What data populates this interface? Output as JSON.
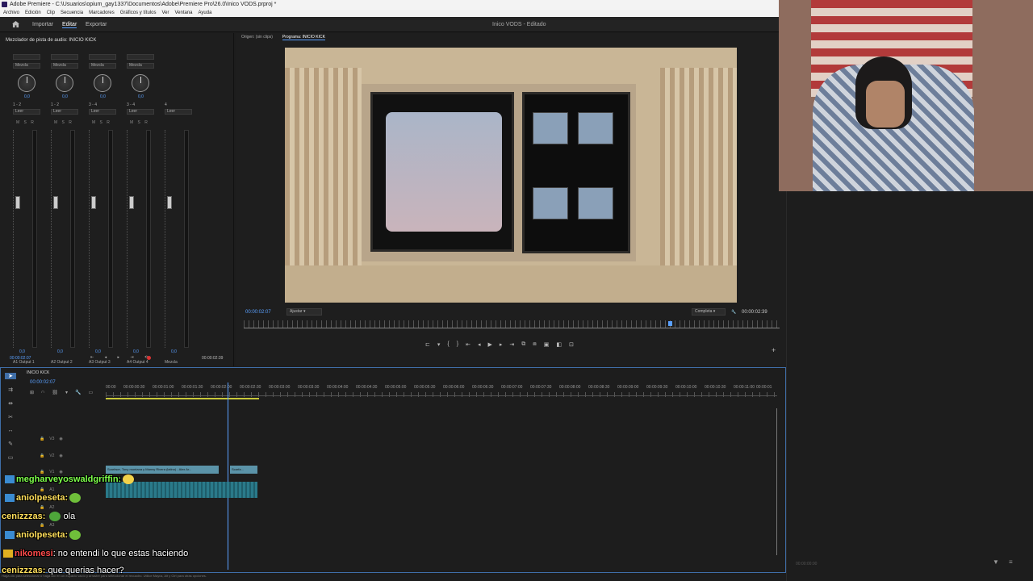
{
  "window": {
    "title": "Adobe Premiere - C:\\Usuarios\\opium_gay1337\\Documentos\\Adobe\\Premiere Pro\\26.0\\Inico VODS.prproj *"
  },
  "menu": [
    "Archivo",
    "Edición",
    "Clip",
    "Secuencia",
    "Marcadores",
    "Gráficos y títulos",
    "Ver",
    "Ventana",
    "Ayuda"
  ],
  "workspace": {
    "tabs": [
      "Importar",
      "Editar",
      "Exportar"
    ],
    "active": "Editar",
    "doc_title": "Inico VODS - Editado"
  },
  "mixer": {
    "title": "Mezclador de pista de audio: INICIO KICK",
    "channels": [
      {
        "mode": "Mezcla",
        "value": "0,0",
        "route": "1 - 2",
        "auto": "Leer",
        "foot": "0,0",
        "label": "A1",
        "output": "Output 1"
      },
      {
        "mode": "Mezcla",
        "value": "0,0",
        "route": "1 - 2",
        "auto": "Leer",
        "foot": "0,0",
        "label": "A2",
        "output": "Output 2"
      },
      {
        "mode": "Mezcla",
        "value": "0,0",
        "route": "3 - 4",
        "auto": "Leer",
        "foot": "0,0",
        "label": "A3",
        "output": "Output 3"
      },
      {
        "mode": "Mezcla",
        "value": "0,0",
        "route": "3 - 4",
        "auto": "Leer",
        "foot": "0,0",
        "label": "A4",
        "output": "Output 4"
      },
      {
        "mode": "",
        "value": "",
        "route": "4",
        "auto": "Leer",
        "foot": "0,0",
        "label": "",
        "output": "Mezcla"
      }
    ],
    "time_left": "00:00:02:07",
    "time_right": "00:00:02:39"
  },
  "program": {
    "source_tab": "Origen: (sin clips)",
    "program_tab": "Programa: INICIO KICK",
    "timecode": "00:00:02:07",
    "fit": "Ajustar",
    "quality": "Completa",
    "duration": "00:00:02:39"
  },
  "timeline": {
    "sequence": "INICIO KICK",
    "timecode": "00:00:02:07",
    "ruler": [
      "00:00",
      "00:00:00:30",
      "00:00:01:00",
      "00:00:01:30",
      "00:00:02:00",
      "00:00:02:30",
      "00:00:03:00",
      "00:00:03:30",
      "00:00:04:00",
      "00:00:04:30",
      "00:00:05:00",
      "00:00:05:30",
      "00:00:06:00",
      "00:00:06:30",
      "00:00:07:00",
      "00:00:07:30",
      "00:00:08:00",
      "00:00:08:30",
      "00:00:09:00",
      "00:00:09:30",
      "00:00:10:00",
      "00:00:10:30",
      "00:00:11:00",
      "00:00:01"
    ],
    "tracks": [
      "V3",
      "V2",
      "V1",
      "A1",
      "A2",
      "A3"
    ],
    "clip1": "Scarface, Tony montana y Manny Rivera (latino) - Alex Ar...",
    "clip2": "Scarfa...",
    "hint": "Haga clic para seleccionar o haga clic en un espacio vacío y arrastre para seleccionar el recuadro. Utilice Mayús, Alt y Ctrl para otras opciones."
  },
  "right_panel": {
    "timecode": "00:00:00:00"
  },
  "chat": [
    {
      "nick": "megharveyoswaldgriffin:",
      "text": "",
      "color": "#7dff4a"
    },
    {
      "nick": "aniolpeseta:",
      "text": "",
      "color": "#ffdf5a"
    },
    {
      "nick": "cenizzzas:",
      "text": "ola",
      "color": "#ffdf5a"
    },
    {
      "nick": "aniolpeseta:",
      "text": "",
      "color": "#ffdf5a"
    },
    {
      "nick": "nikomesi",
      "text": ": no entendi lo que estas haciendo",
      "color": "#ff4a4a"
    },
    {
      "nick": "cenizzzas:",
      "text": "que querias hacer?",
      "color": "#ffdf5a"
    }
  ],
  "colors": {
    "accent": "#5aa0ff",
    "panel": "#1e1e1e",
    "clip": "#5b93a8",
    "inout": "#c8c83a"
  },
  "icons": [
    "home-icon",
    "selection-tool-icon",
    "razor-tool-icon",
    "wrench-icon",
    "play-icon",
    "lock-icon",
    "eye-icon",
    "filter-icon",
    "settings-icon"
  ]
}
